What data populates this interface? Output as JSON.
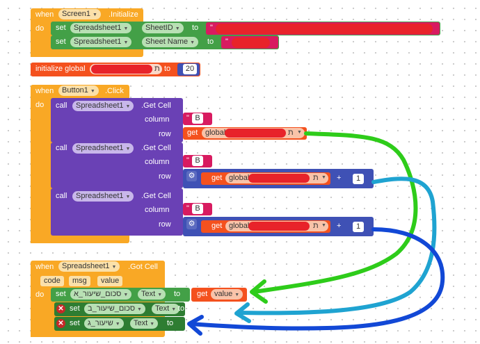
{
  "screen_init": {
    "when": "when",
    "component": "Screen1",
    "event": ".Initialize",
    "do": "do",
    "set1": {
      "set": "set",
      "component": "Spreadsheet1",
      "prop": "SheetID",
      "to": "to",
      "quote": "\""
    },
    "set2": {
      "set": "set",
      "component": "Spreadsheet1",
      "prop": "Sheet Name",
      "to": "to",
      "quote": "\""
    }
  },
  "global_init": {
    "label": "initialize global",
    "trail": "ת",
    "to": "to",
    "value": "20"
  },
  "button_click": {
    "when": "when",
    "component": "Button1",
    "event": ".Click",
    "do": "do",
    "calls": [
      {
        "call": "call",
        "component": "Spreadsheet1",
        "method": ".Get Cell",
        "column_label": "column",
        "row_label": "row",
        "column_value": "B",
        "get": "get",
        "var": "global",
        "var_trail": "ת"
      },
      {
        "call": "call",
        "component": "Spreadsheet1",
        "method": ".Get Cell",
        "column_label": "column",
        "row_label": "row",
        "column_value": "B",
        "get": "get",
        "var": "global",
        "var_trail": "ת",
        "op": "+",
        "add": "1"
      },
      {
        "call": "call",
        "component": "Spreadsheet1",
        "method": ".Get Cell",
        "column_label": "column",
        "row_label": "row",
        "column_value": "B",
        "get": "get",
        "var": "global",
        "var_trail": "ת",
        "op": "+",
        "add": "1"
      }
    ]
  },
  "got_cell": {
    "when": "when",
    "component": "Spreadsheet1",
    "event": ".Got Cell",
    "do": "do",
    "params": [
      "code",
      "msg",
      "value"
    ],
    "sets": [
      {
        "set": "set",
        "component": "סכום_שיעור_א",
        "prop": "Text",
        "to": "to",
        "get": "get",
        "var": "value"
      },
      {
        "set": "set",
        "component": "סכום_שיעור_ב",
        "prop": "Text",
        "to": "to"
      },
      {
        "set": "set",
        "component": "שיעור_ג",
        "prop": "Text",
        "to": "to"
      }
    ]
  },
  "colors": {
    "event": "#f9a825",
    "set": "#43a047",
    "call": "#6a41b5",
    "text": "#d81b60",
    "var": "#f4511e",
    "math": "#3f51b5",
    "arrow_green": "#2ecc1a",
    "arrow_cyan": "#1fa3d1",
    "arrow_blue": "#1248d6"
  }
}
